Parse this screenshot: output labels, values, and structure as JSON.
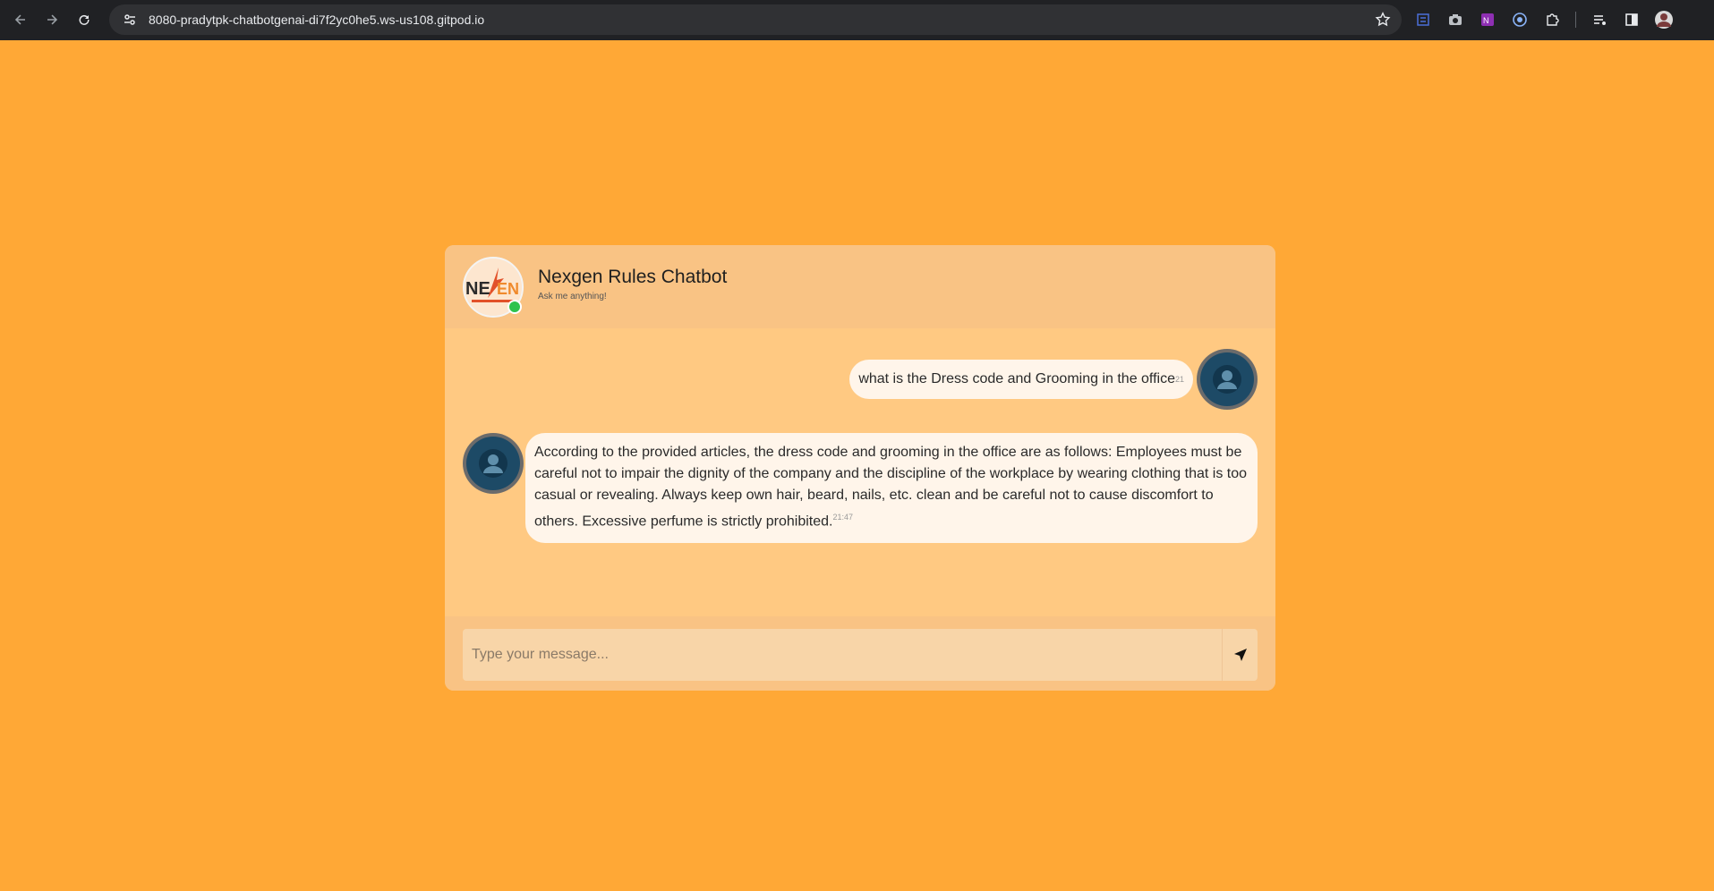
{
  "browser": {
    "url": "8080-pradytpk-chatbotgenai-di7f2yc0he5.ws-us108.gitpod.io"
  },
  "chat": {
    "title": "Nexgen Rules Chatbot",
    "subtitle": "Ask me anything!",
    "logo_text": "NEXGEN",
    "messages": [
      {
        "sender": "user",
        "text": "what is the Dress code and Grooming in the office",
        "time": "21"
      },
      {
        "sender": "bot",
        "text": "According to the provided articles, the dress code and grooming in the office are as follows: Employees must be careful not to impair the dignity of the company and the discipline of the workplace by wearing clothing that is too casual or revealing. Always keep own hair, beard, nails, etc. clean and be careful not to cause discomfort to others. Excessive perfume is strictly prohibited.",
        "time": "21:47"
      }
    ],
    "input_placeholder": "Type your message..."
  },
  "colors": {
    "page_bg": "#ffa836",
    "card_bg": "#ffc982",
    "header_bg": "#f9c384",
    "bubble_bg": "#fff5ea",
    "avatar_bg": "#1d4a66",
    "online": "#2ec34d"
  }
}
